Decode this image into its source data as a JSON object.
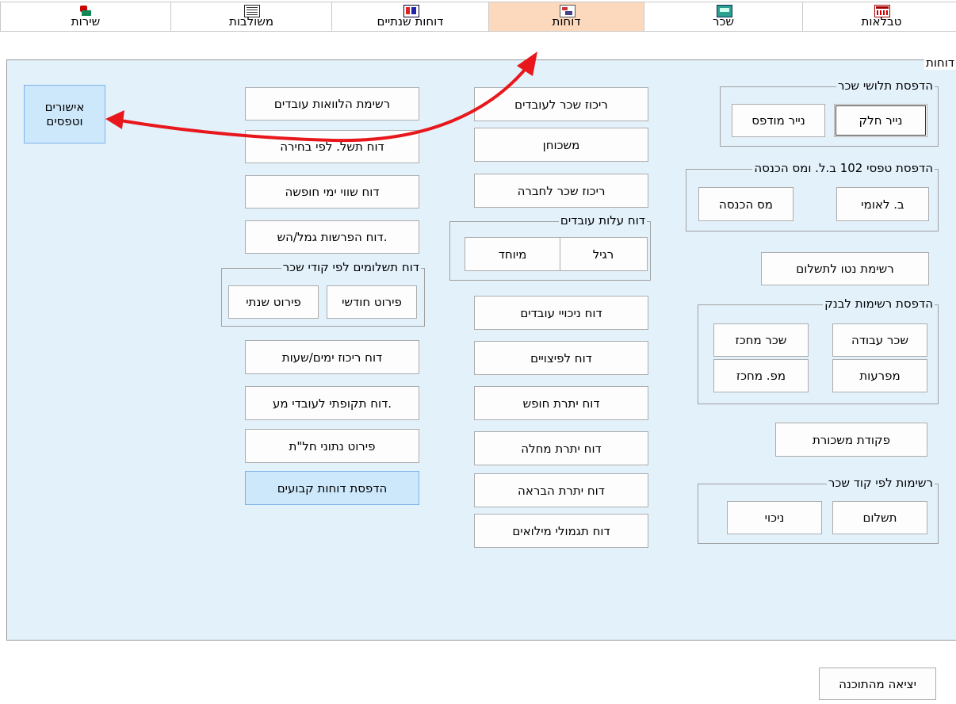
{
  "tabs": {
    "tables": "טבלאות",
    "salary": "שכר",
    "reports": "דוחות",
    "annual_reports": "דוחות שנתיים",
    "integrations": "משולבות",
    "service": "שירות"
  },
  "panel": {
    "title": "דוחות"
  },
  "payslip_group": {
    "legend": "הדפסת תלושי שכר",
    "plain_paper": "נייר חלק",
    "printed_paper": "נייר מודפס"
  },
  "form102_group": {
    "legend": "הדפסת טפסי 102 ב.ל. ומס הכנסה",
    "nii": "ב. לאומי",
    "income_tax": "מס הכנסה"
  },
  "net_payment_list": "רשימת נטו לתשלום",
  "bank_group": {
    "legend": "הדפסת רשימות לבנק",
    "work_salary": "שכר עבודה",
    "salary_center": "שכר מחכז",
    "deductions": "מפרעות",
    "mp_center": "מפ. מחכז"
  },
  "salary_order": "פקודת משכורת",
  "codes_group": {
    "legend": "רשימות לפי קוד שכר",
    "payment": "תשלום",
    "deduction": "ניכוי"
  },
  "middle": {
    "salary_summary_employees": "ריכוז שכר לעובדים",
    "mortgage": "משכוחן",
    "salary_summary_company": "ריכוז שכר לחברה",
    "cost_group": {
      "legend": "דוח עלות עובדים",
      "regular": "רגיל",
      "special": "מיוחד"
    },
    "employee_deductions": "דוח ניכויי עובדים",
    "severance": "דוח לפיצויים",
    "vacation_balance": "דוח יתרת חופש",
    "sick_balance": "דוח יתרת מחלה",
    "recovery_balance": "דוח יתרת הבראה",
    "reserve_pay": "דוח תגמולי מילואים"
  },
  "left": {
    "employee_loans": "רשימת הלוואות עובדים",
    "payslip_by_choice": "דוח תשל. לפי בחירה",
    "vacation_value": "דוח שווי ימי חופשה",
    "pension_deposits": "דוח הפרשות גמל/הש.",
    "payments_group": {
      "legend": "דוח תשלומים לפי קודי שכר",
      "monthly": "פירוט חודשי",
      "yearly": "פירוט שנתי"
    },
    "days_hours_summary": "דוח ריכוז ימים/שעות",
    "periodic_report": "דוח תקופתי לעובדי מע.",
    "abroad_details": "פירוט נתוני חל\"ת",
    "print_fixed_reports": "הדפסת דוחות קבועים"
  },
  "approvals": {
    "line1": "אישורים",
    "line2": "וטפסים"
  },
  "exit": "יציאה מהתוכנה",
  "colors": {
    "active_tab": "#fcd9bd",
    "panel_bg": "#e3f1fb",
    "highlight_btn": "#cde8fb",
    "annotation_arrow": "#e8171c"
  }
}
